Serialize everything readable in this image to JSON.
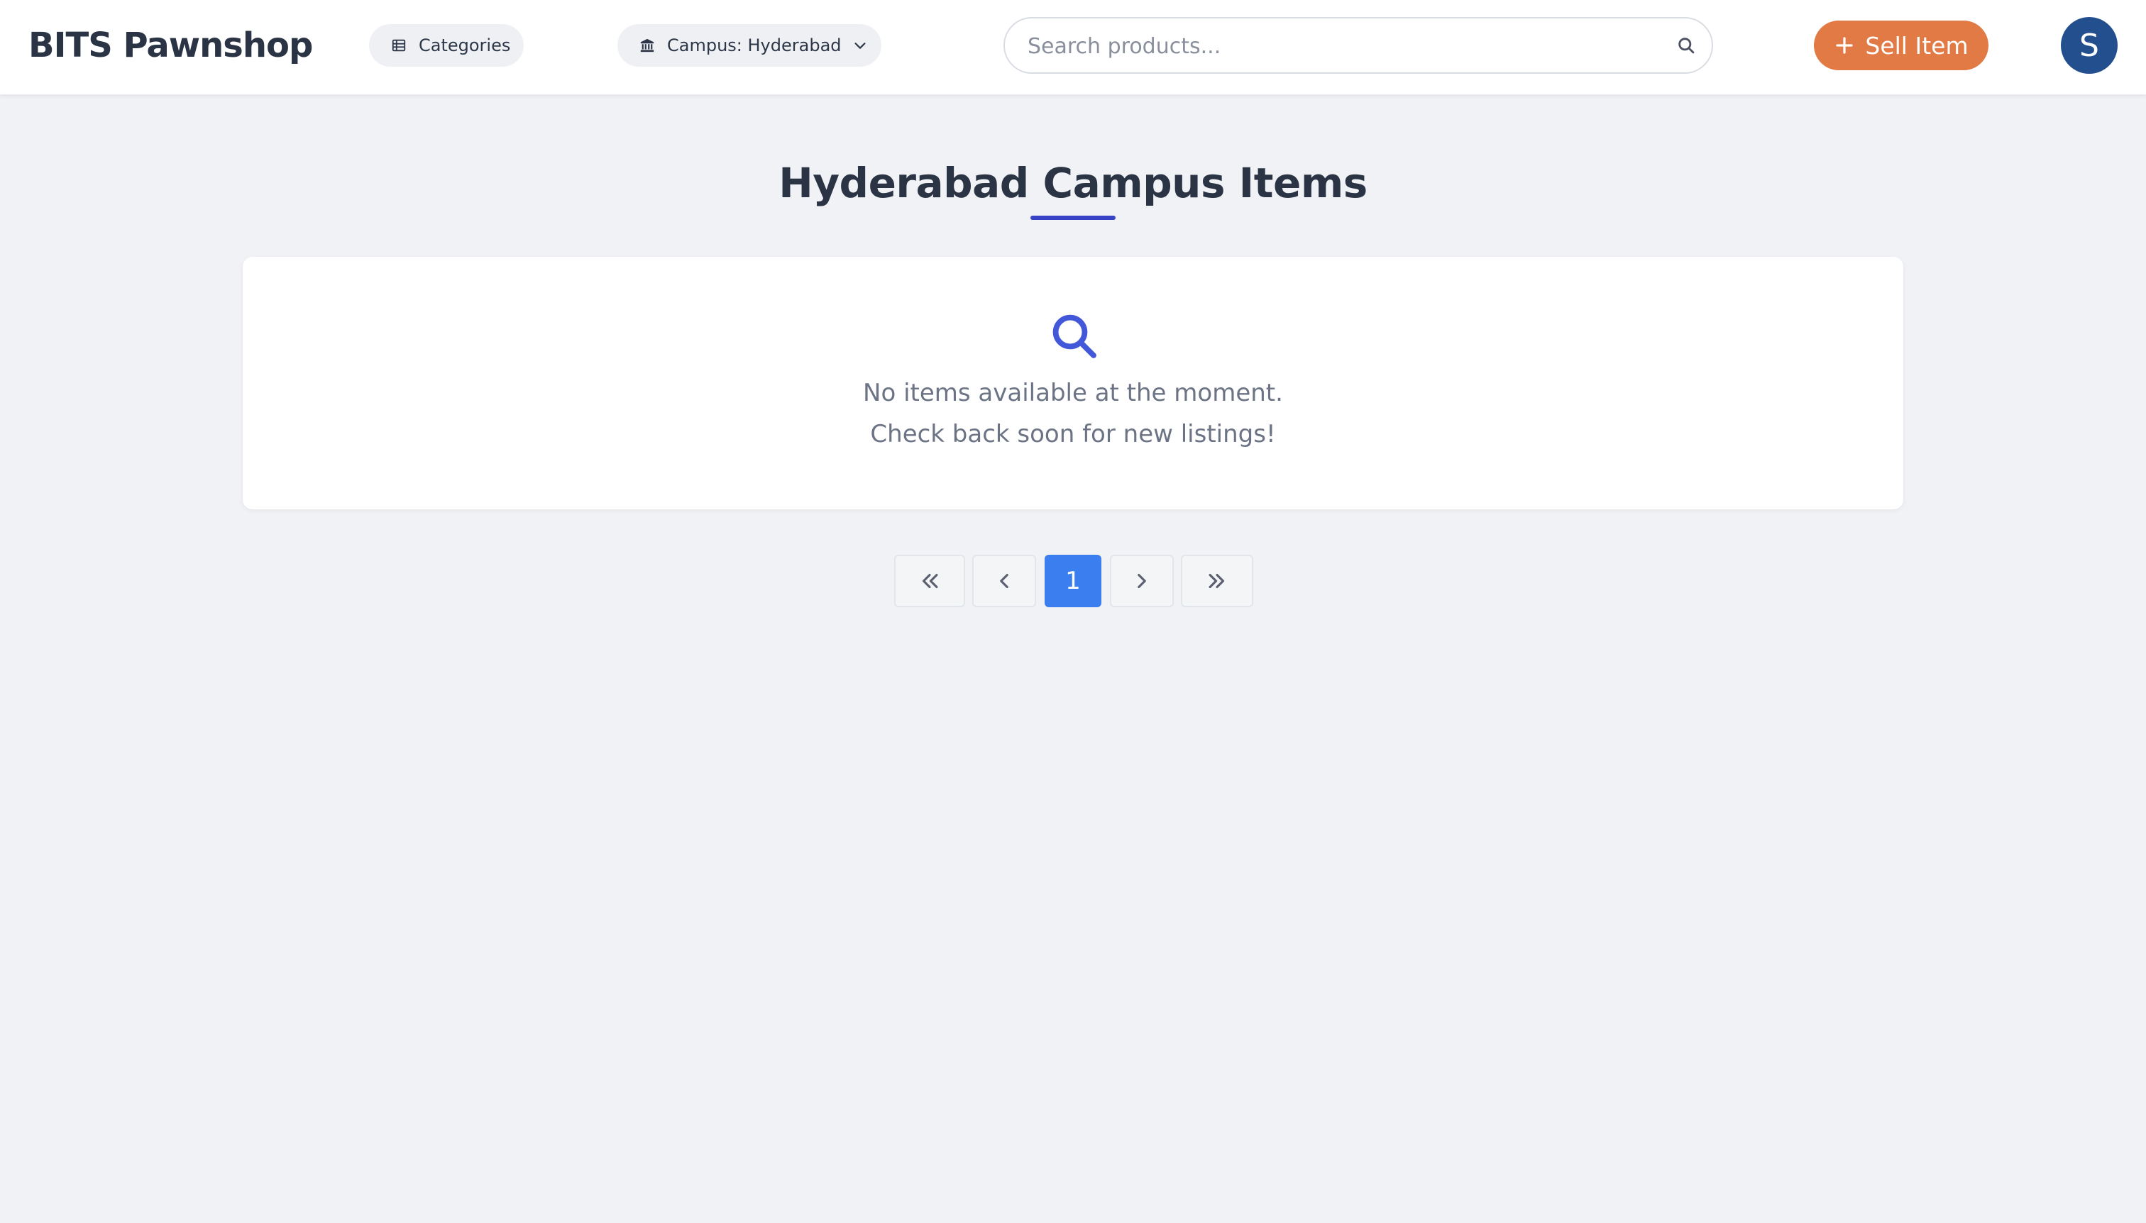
{
  "header": {
    "brand": "BITS Pawnshop",
    "categories_label": "Categories",
    "campus_label": "Campus: Hyderabad",
    "search_placeholder": "Search products...",
    "sell_label": "Sell Item",
    "avatar_initial": "S"
  },
  "main": {
    "title": "Hyderabad Campus Items",
    "empty_line_1": "No items available at the moment.",
    "empty_line_2": "Check back soon for new listings!"
  },
  "pagination": {
    "current_page": "1"
  },
  "icons": {
    "categories": "list-icon",
    "campus": "bank-icon",
    "dropdown": "chevron-down-icon",
    "search": "search-icon",
    "sell": "plus-icon",
    "empty": "search-icon",
    "first": "double-chevron-left-icon",
    "prev": "chevron-left-icon",
    "next": "chevron-right-icon",
    "last": "double-chevron-right-icon"
  },
  "colors": {
    "accent": "#3b7ef0",
    "sell_button": "#e27a45",
    "avatar": "#234f8f",
    "title_underline": "#3742c6",
    "empty_icon": "#4258d8"
  }
}
